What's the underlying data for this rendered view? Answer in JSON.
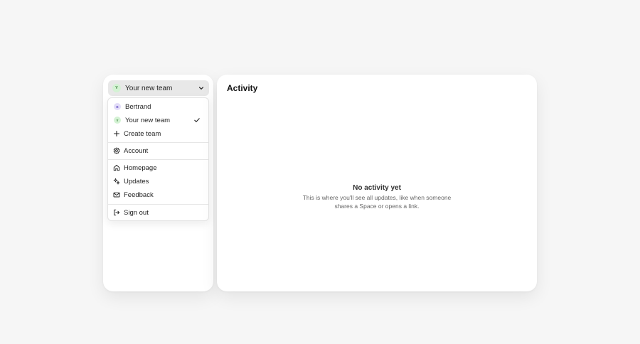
{
  "team_switcher": {
    "avatar_initial": "Y",
    "label": "Your new team",
    "icon": "chevron-down-icon"
  },
  "menu": {
    "teams": [
      {
        "avatar_initial": "B",
        "label": "Bertrand",
        "avatar_color": "#e2dcf8",
        "selected": false
      },
      {
        "avatar_initial": "Y",
        "label": "Your new team",
        "avatar_color": "#d4f2d4",
        "selected": true
      }
    ],
    "create_team": {
      "label": "Create team",
      "icon": "plus-icon"
    },
    "account": {
      "label": "Account",
      "icon": "gear-icon"
    },
    "homepage": {
      "label": "Homepage",
      "icon": "home-icon"
    },
    "updates": {
      "label": "Updates",
      "icon": "sparkles-icon"
    },
    "feedback": {
      "label": "Feedback",
      "icon": "mail-icon"
    },
    "sign_out": {
      "label": "Sign out",
      "icon": "sign-out-icon"
    }
  },
  "main": {
    "title": "Activity",
    "empty_title": "No activity yet",
    "empty_description": "This is where you'll see all updates, like when someone shares a Space or opens a link."
  },
  "colors": {
    "background": "#f6f6f6",
    "panel": "#ffffff",
    "switcher_bg": "#e8e8e8"
  }
}
